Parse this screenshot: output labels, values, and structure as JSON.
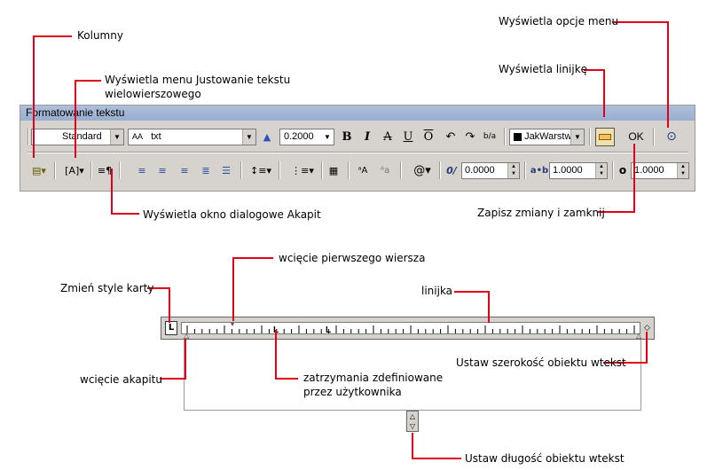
{
  "callouts": {
    "kolumny": "Kolumny",
    "justowanie_line1": "Wyświetla menu Justowanie tekstu",
    "justowanie_line2": "wielowierszowego",
    "opcje_menu": "Wyświetla opcje menu",
    "linijke": "Wyświetla linijkę",
    "akapit": "Wyświetla okno dialogowe Akapit",
    "zapisz": "Zapisz zmiany i zamknij",
    "wciecie_pierwszego": "wcięcie pierwszego wiersza",
    "zmien_style": "Zmień style karty",
    "linijka": "linijka",
    "wciecie_akapitu": "wcięcie akapitu",
    "zatrzymania_line1": "zatrzymania zdefiniowane",
    "zatrzymania_line2": "przez użytkownika",
    "ustaw_szerokosc": "Ustaw szerokość obiektu wtekst",
    "ustaw_dlugosc": "Ustaw długość obiektu wtekst"
  },
  "toolbar": {
    "title": "Formatowanie tekstu",
    "style_value": "Standard",
    "font_value": "txt",
    "font_icon": "AA",
    "height_value": "0.2000",
    "bold": "B",
    "italic": "I",
    "strike": "A",
    "underline": "U",
    "overline": "O",
    "stack_icon": "b/a",
    "color_value": "JakWarstw",
    "ok_label": "OK",
    "oblique_value": "0.0000",
    "tracking_value": "1.0000",
    "width_value": "1.0000",
    "oblique_icon": "0/",
    "tracking_icon": "a•b",
    "width_icon": "o",
    "symbol_icon": "@"
  },
  "colors": {
    "callout_red": "#e0001b",
    "titlebar": "#a8bad6",
    "toolbar_bg": "#d6d3ce"
  }
}
